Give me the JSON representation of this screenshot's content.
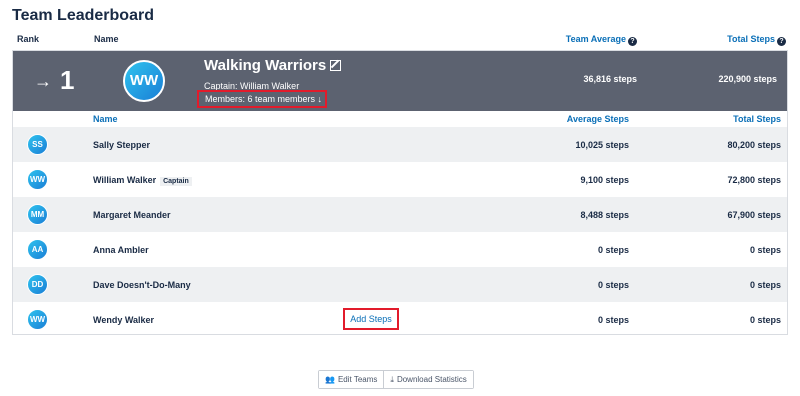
{
  "title": "Team Leaderboard",
  "headers": {
    "rank": "Rank",
    "name": "Name",
    "team_average": "Team Average",
    "total_steps": "Total Steps",
    "help_glyph": "?"
  },
  "team": {
    "arrow": "→",
    "rank": "1",
    "initials": "WW",
    "name": "Walking Warriors",
    "captain": "Captain: William Walker",
    "members": "Members: 6 team members ↓",
    "average": "36,816 steps",
    "total": "220,900 steps"
  },
  "member_headers": {
    "name": "Name",
    "average": "Average Steps",
    "total": "Total Steps"
  },
  "members": [
    {
      "initials": "SS",
      "name": "Sally Stepper",
      "average": "10,025 steps",
      "total": "80,200 steps"
    },
    {
      "initials": "WW",
      "name": "William Walker",
      "badge": "Captain",
      "average": "9,100 steps",
      "total": "72,800 steps"
    },
    {
      "initials": "MM",
      "name": "Margaret Meander",
      "average": "8,488 steps",
      "total": "67,900 steps"
    },
    {
      "initials": "AA",
      "name": "Anna Ambler",
      "average": "0 steps",
      "total": "0 steps"
    },
    {
      "initials": "DD",
      "name": "Dave Doesn't-Do-Many",
      "average": "0 steps",
      "total": "0 steps"
    },
    {
      "initials": "WW",
      "name": "Wendy Walker",
      "action": "Add Steps",
      "average": "0 steps",
      "total": "0 steps"
    }
  ],
  "actions": {
    "edit_teams": "Edit Teams",
    "download_statistics": "Download Statistics",
    "edit_icon_glyph": "👥",
    "download_icon_glyph": "⤓"
  }
}
